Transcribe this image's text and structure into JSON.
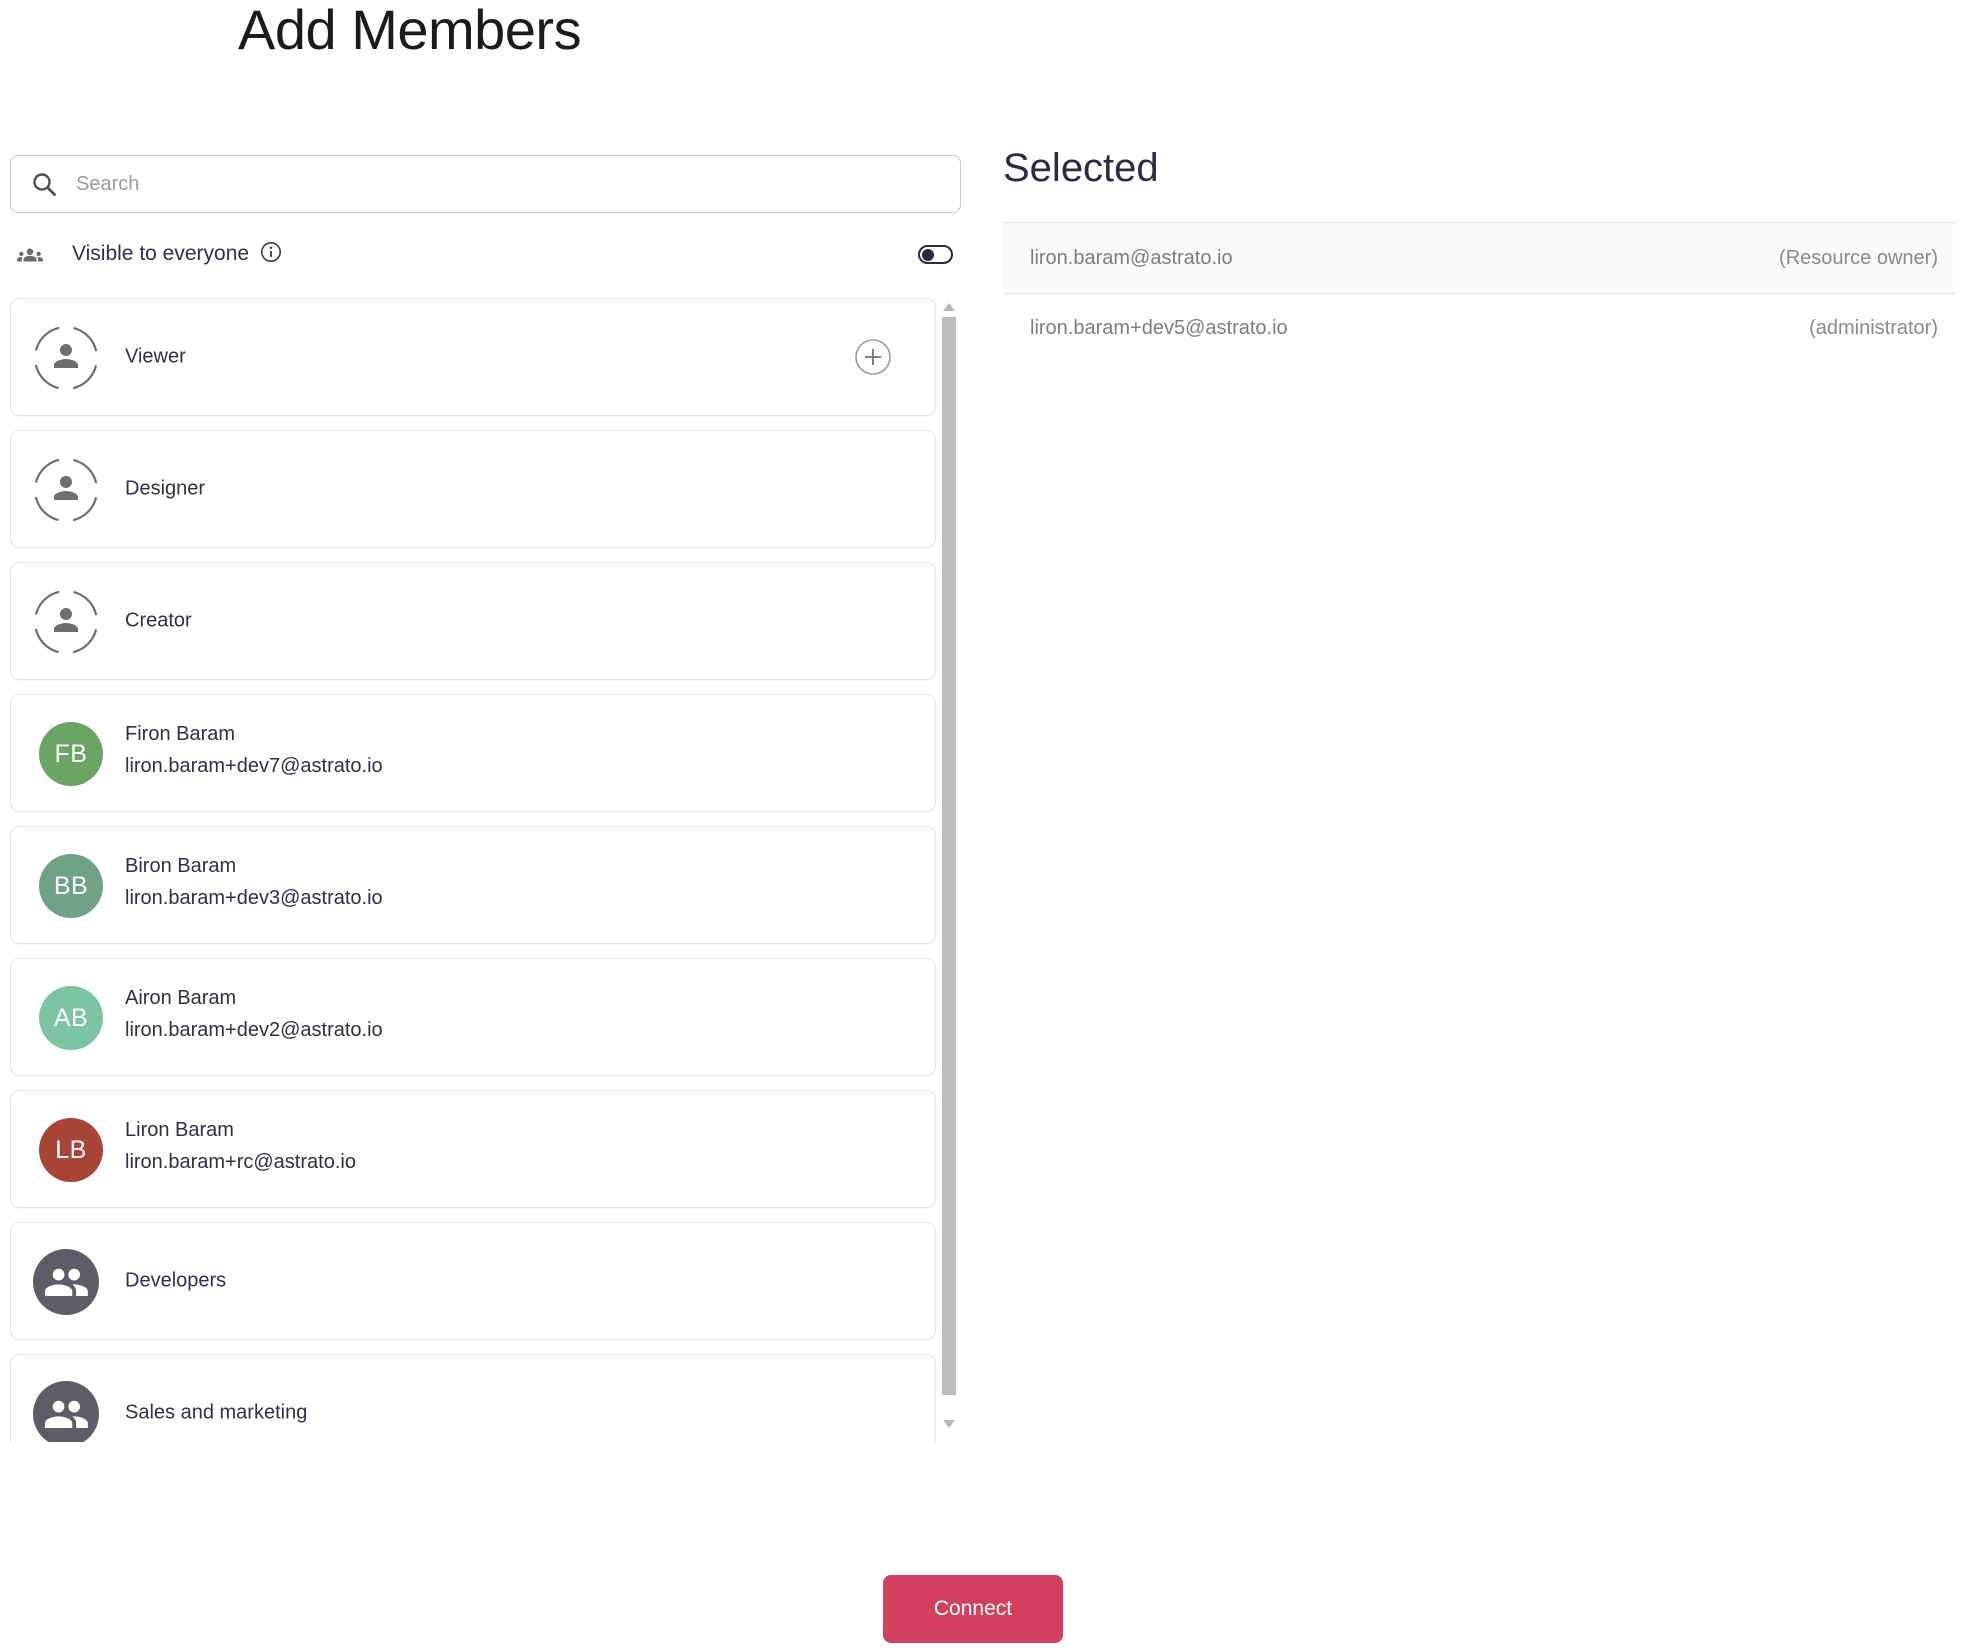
{
  "dialog": {
    "title": "Add Members"
  },
  "search": {
    "placeholder": "Search",
    "value": ""
  },
  "visibility": {
    "label": "Visible to everyone",
    "enabled": false
  },
  "members": {
    "items": [
      {
        "kind": "role",
        "label": "Viewer",
        "show_add_button": true
      },
      {
        "kind": "role",
        "label": "Designer",
        "show_add_button": false
      },
      {
        "kind": "role",
        "label": "Creator",
        "show_add_button": false
      },
      {
        "kind": "user",
        "initials": "FB",
        "avatar_color": "#6aa564",
        "name": "Firon Baram",
        "email": "liron.baram+dev7@astrato.io"
      },
      {
        "kind": "user",
        "initials": "BB",
        "avatar_color": "#6fa287",
        "name": "Biron Baram",
        "email": "liron.baram+dev3@astrato.io"
      },
      {
        "kind": "user",
        "initials": "AB",
        "avatar_color": "#7cc4a4",
        "name": "Airon Baram",
        "email": "liron.baram+dev2@astrato.io"
      },
      {
        "kind": "user",
        "initials": "LB",
        "avatar_color": "#a84536",
        "name": "Liron Baram",
        "email": "liron.baram+rc@astrato.io"
      },
      {
        "kind": "group",
        "label": "Developers"
      },
      {
        "kind": "group",
        "label": "Sales and marketing"
      }
    ]
  },
  "selected": {
    "heading": "Selected",
    "rows": [
      {
        "email": "liron.baram@astrato.io",
        "role": "(Resource owner)"
      },
      {
        "email": "liron.baram+dev5@astrato.io",
        "role": "(administrator)"
      }
    ]
  },
  "actions": {
    "connect": "Connect"
  },
  "icons": {
    "search": "search-icon",
    "info": "info-icon",
    "visibility": "groups-icon",
    "add": "plus-icon",
    "role_avatar": "person-dashed-circle-icon",
    "group_avatar": "people-circle-icon",
    "scrollbar_up": "triangle-up-icon",
    "scrollbar_down": "triangle-down-icon"
  },
  "colors": {
    "accent": "#d1415f",
    "toggle": "#2b2b40",
    "group_avatar": "#5d5d67"
  }
}
